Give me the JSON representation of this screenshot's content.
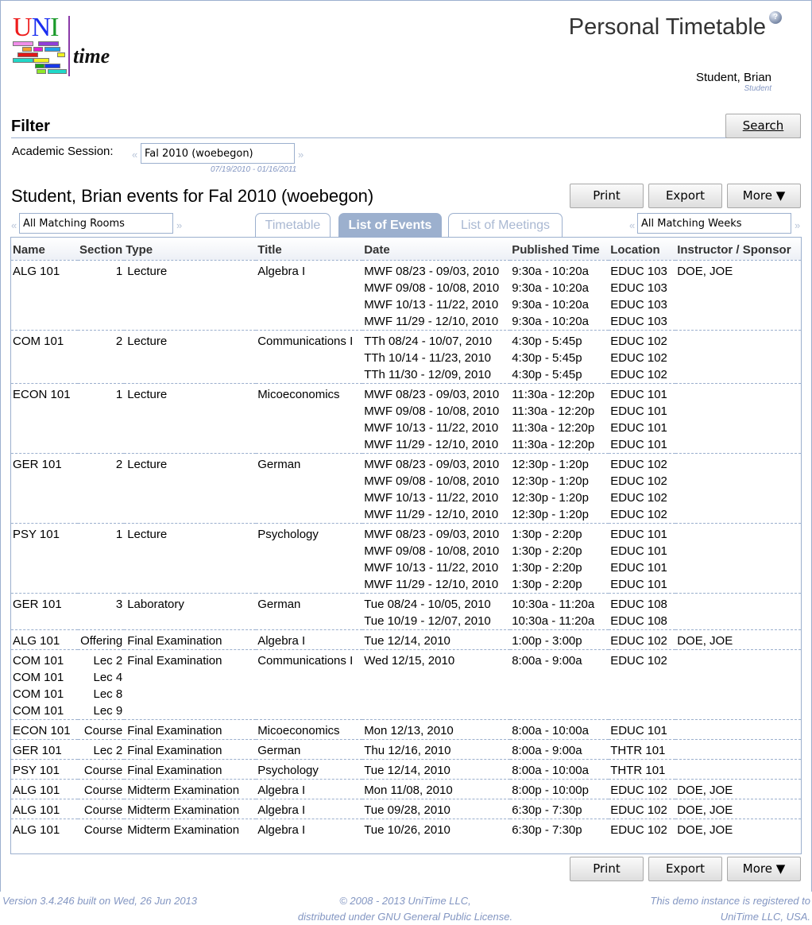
{
  "app": {
    "logo_text_1": "U",
    "logo_text_2": "N",
    "logo_text_3": "I",
    "logo_text_4": "time",
    "page_title": "Personal Timetable",
    "help_icon": "?",
    "user_name": "Student, Brian",
    "user_role": "Student"
  },
  "filter": {
    "title": "Filter",
    "search_button": "Search",
    "session_label": "Academic Session:",
    "session_value": "Fal 2010 (woebegon)",
    "session_dates": "07/19/2010 - 01/16/2011",
    "prev_arrow": "«",
    "next_arrow": "»"
  },
  "events": {
    "title": "Student, Brian events for Fal 2010 (woebegon)",
    "buttons": {
      "print": "Print",
      "export": "Export",
      "more": "More ▼"
    },
    "rooms_filter": "All Matching Rooms",
    "weeks_filter": "All Matching Weeks",
    "tabs": [
      {
        "label": "Timetable",
        "active": false
      },
      {
        "label": "List of Events",
        "active": true
      },
      {
        "label": "List of Meetings",
        "active": false
      }
    ],
    "columns": [
      "Name",
      "Section",
      "Type",
      "Title",
      "Date",
      "Published Time",
      "Location",
      "Instructor / Sponsor"
    ],
    "rows": [
      {
        "name": [
          "ALG 101"
        ],
        "section": [
          "1"
        ],
        "type": "Lecture",
        "title": "Algebra I",
        "dates": [
          "MWF 08/23 - 09/03, 2010",
          "MWF 09/08 - 10/08, 2010",
          "MWF 10/13 - 11/22, 2010",
          "MWF 11/29 - 12/10, 2010"
        ],
        "times": [
          "9:30a - 10:20a",
          "9:30a - 10:20a",
          "9:30a - 10:20a",
          "9:30a - 10:20a"
        ],
        "locations": [
          "EDUC 103",
          "EDUC 103",
          "EDUC 103",
          "EDUC 103"
        ],
        "instructor": "DOE, JOE"
      },
      {
        "name": [
          "COM 101"
        ],
        "section": [
          "2"
        ],
        "type": "Lecture",
        "title": "Communications I",
        "dates": [
          "TTh 08/24 - 10/07, 2010",
          "TTh 10/14 - 11/23, 2010",
          "TTh 11/30 - 12/09, 2010"
        ],
        "times": [
          "4:30p - 5:45p",
          "4:30p - 5:45p",
          "4:30p - 5:45p"
        ],
        "locations": [
          "EDUC 102",
          "EDUC 102",
          "EDUC 102"
        ],
        "instructor": ""
      },
      {
        "name": [
          "ECON 101"
        ],
        "section": [
          "1"
        ],
        "type": "Lecture",
        "title": "Micoeconomics",
        "dates": [
          "MWF 08/23 - 09/03, 2010",
          "MWF 09/08 - 10/08, 2010",
          "MWF 10/13 - 11/22, 2010",
          "MWF 11/29 - 12/10, 2010"
        ],
        "times": [
          "11:30a - 12:20p",
          "11:30a - 12:20p",
          "11:30a - 12:20p",
          "11:30a - 12:20p"
        ],
        "locations": [
          "EDUC 101",
          "EDUC 101",
          "EDUC 101",
          "EDUC 101"
        ],
        "instructor": ""
      },
      {
        "name": [
          "GER 101"
        ],
        "section": [
          "2"
        ],
        "type": "Lecture",
        "title": "German",
        "dates": [
          "MWF 08/23 - 09/03, 2010",
          "MWF 09/08 - 10/08, 2010",
          "MWF 10/13 - 11/22, 2010",
          "MWF 11/29 - 12/10, 2010"
        ],
        "times": [
          "12:30p - 1:20p",
          "12:30p - 1:20p",
          "12:30p - 1:20p",
          "12:30p - 1:20p"
        ],
        "locations": [
          "EDUC 102",
          "EDUC 102",
          "EDUC 102",
          "EDUC 102"
        ],
        "instructor": ""
      },
      {
        "name": [
          "PSY 101"
        ],
        "section": [
          "1"
        ],
        "type": "Lecture",
        "title": "Psychology",
        "dates": [
          "MWF 08/23 - 09/03, 2010",
          "MWF 09/08 - 10/08, 2010",
          "MWF 10/13 - 11/22, 2010",
          "MWF 11/29 - 12/10, 2010"
        ],
        "times": [
          "1:30p - 2:20p",
          "1:30p - 2:20p",
          "1:30p - 2:20p",
          "1:30p - 2:20p"
        ],
        "locations": [
          "EDUC 101",
          "EDUC 101",
          "EDUC 101",
          "EDUC 101"
        ],
        "instructor": ""
      },
      {
        "name": [
          "GER 101"
        ],
        "section": [
          "3"
        ],
        "type": "Laboratory",
        "title": "German",
        "dates": [
          "Tue 08/24 - 10/05, 2010",
          "Tue 10/19 - 12/07, 2010"
        ],
        "times": [
          "10:30a - 11:20a",
          "10:30a - 11:20a"
        ],
        "locations": [
          "EDUC 108",
          "EDUC 108"
        ],
        "instructor": ""
      },
      {
        "name": [
          "ALG 101"
        ],
        "section": [
          "Offering"
        ],
        "type": "Final Examination",
        "title": "Algebra I",
        "dates": [
          "Tue 12/14, 2010"
        ],
        "times": [
          "1:00p - 3:00p"
        ],
        "locations": [
          "EDUC 102"
        ],
        "instructor": "DOE, JOE"
      },
      {
        "name": [
          "COM 101",
          "COM 101",
          "COM 101",
          "COM 101"
        ],
        "section": [
          "Lec 2",
          "Lec 4",
          "Lec 8",
          "Lec 9"
        ],
        "type": "Final Examination",
        "title": "Communications I",
        "dates": [
          "Wed 12/15, 2010"
        ],
        "times": [
          "8:00a - 9:00a"
        ],
        "locations": [
          "EDUC 102"
        ],
        "instructor": ""
      },
      {
        "name": [
          "ECON 101"
        ],
        "section": [
          "Course"
        ],
        "type": "Final Examination",
        "title": "Micoeconomics",
        "dates": [
          "Mon 12/13, 2010"
        ],
        "times": [
          "8:00a - 10:00a"
        ],
        "locations": [
          "EDUC 101"
        ],
        "instructor": ""
      },
      {
        "name": [
          "GER 101"
        ],
        "section": [
          "Lec 2"
        ],
        "type": "Final Examination",
        "title": "German",
        "dates": [
          "Thu 12/16, 2010"
        ],
        "times": [
          "8:00a - 9:00a"
        ],
        "locations": [
          "THTR 101"
        ],
        "instructor": ""
      },
      {
        "name": [
          "PSY 101"
        ],
        "section": [
          "Course"
        ],
        "type": "Final Examination",
        "title": "Psychology",
        "dates": [
          "Tue 12/14, 2010"
        ],
        "times": [
          "8:00a - 10:00a"
        ],
        "locations": [
          "THTR 101"
        ],
        "instructor": ""
      },
      {
        "name": [
          "ALG 101"
        ],
        "section": [
          "Course"
        ],
        "type": "Midterm Examination",
        "title": "Algebra I",
        "dates": [
          "Mon 11/08, 2010"
        ],
        "times": [
          "8:00p - 10:00p"
        ],
        "locations": [
          "EDUC 102"
        ],
        "instructor": "DOE, JOE"
      },
      {
        "name": [
          "ALG 101"
        ],
        "section": [
          "Course"
        ],
        "type": "Midterm Examination",
        "title": "Algebra I",
        "dates": [
          "Tue 09/28, 2010"
        ],
        "times": [
          "6:30p - 7:30p"
        ],
        "locations": [
          "EDUC 102"
        ],
        "instructor": "DOE, JOE"
      },
      {
        "name": [
          "ALG 101"
        ],
        "section": [
          "Course"
        ],
        "type": "Midterm Examination",
        "title": "Algebra I",
        "dates": [
          "Tue 10/26, 2010"
        ],
        "times": [
          "6:30p - 7:30p"
        ],
        "locations": [
          "EDUC 102"
        ],
        "instructor": "DOE, JOE"
      }
    ]
  },
  "footer": {
    "version": "Version 3.4.246 built on Wed, 26 Jun 2013",
    "copyright_1": "© 2008 - 2013 UniTime LLC,",
    "copyright_2": "distributed under GNU General Public License.",
    "registered_1": "This demo instance is registered to",
    "registered_2": "UniTime LLC, USA."
  },
  "colors": {
    "accent": "#9cb0ce",
    "muted_text": "#8396c2"
  }
}
